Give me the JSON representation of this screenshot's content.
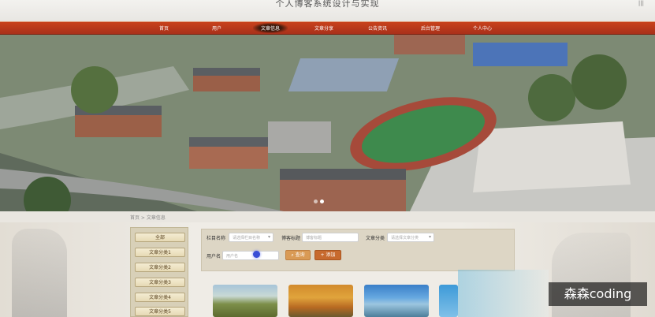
{
  "header": {
    "site_title": "个人博客系统设计与实现",
    "top_links": "|||"
  },
  "nav": {
    "items": [
      "首页",
      "用户",
      "文章信息",
      "文章分享",
      "公告资讯",
      "后台管理",
      "个人中心"
    ],
    "active_index": 2
  },
  "banner": {
    "slide_count": 2,
    "active_slide": 2
  },
  "breadcrumb": "首页 > 文章信息",
  "sidebar": {
    "categories": [
      "全部",
      "文章分类1",
      "文章分类2",
      "文章分类3",
      "文章分类4",
      "文章分类5"
    ]
  },
  "filters": {
    "column_label": "栏目名称",
    "column_placeholder": "请选择栏目名称",
    "title_label": "博客标题",
    "title_placeholder": "博客标题",
    "category_label": "文章分类",
    "category_placeholder": "请选择文章分类",
    "username_label": "用户名",
    "username_placeholder": "用户名",
    "search_label": "查询",
    "add_label": "添加"
  },
  "watermark": "森森coding",
  "colors": {
    "nav_bar": "#b5361a",
    "search_button": "#d99a55",
    "add_button": "#c76a2e",
    "sidebar": "#d8d0b8"
  }
}
